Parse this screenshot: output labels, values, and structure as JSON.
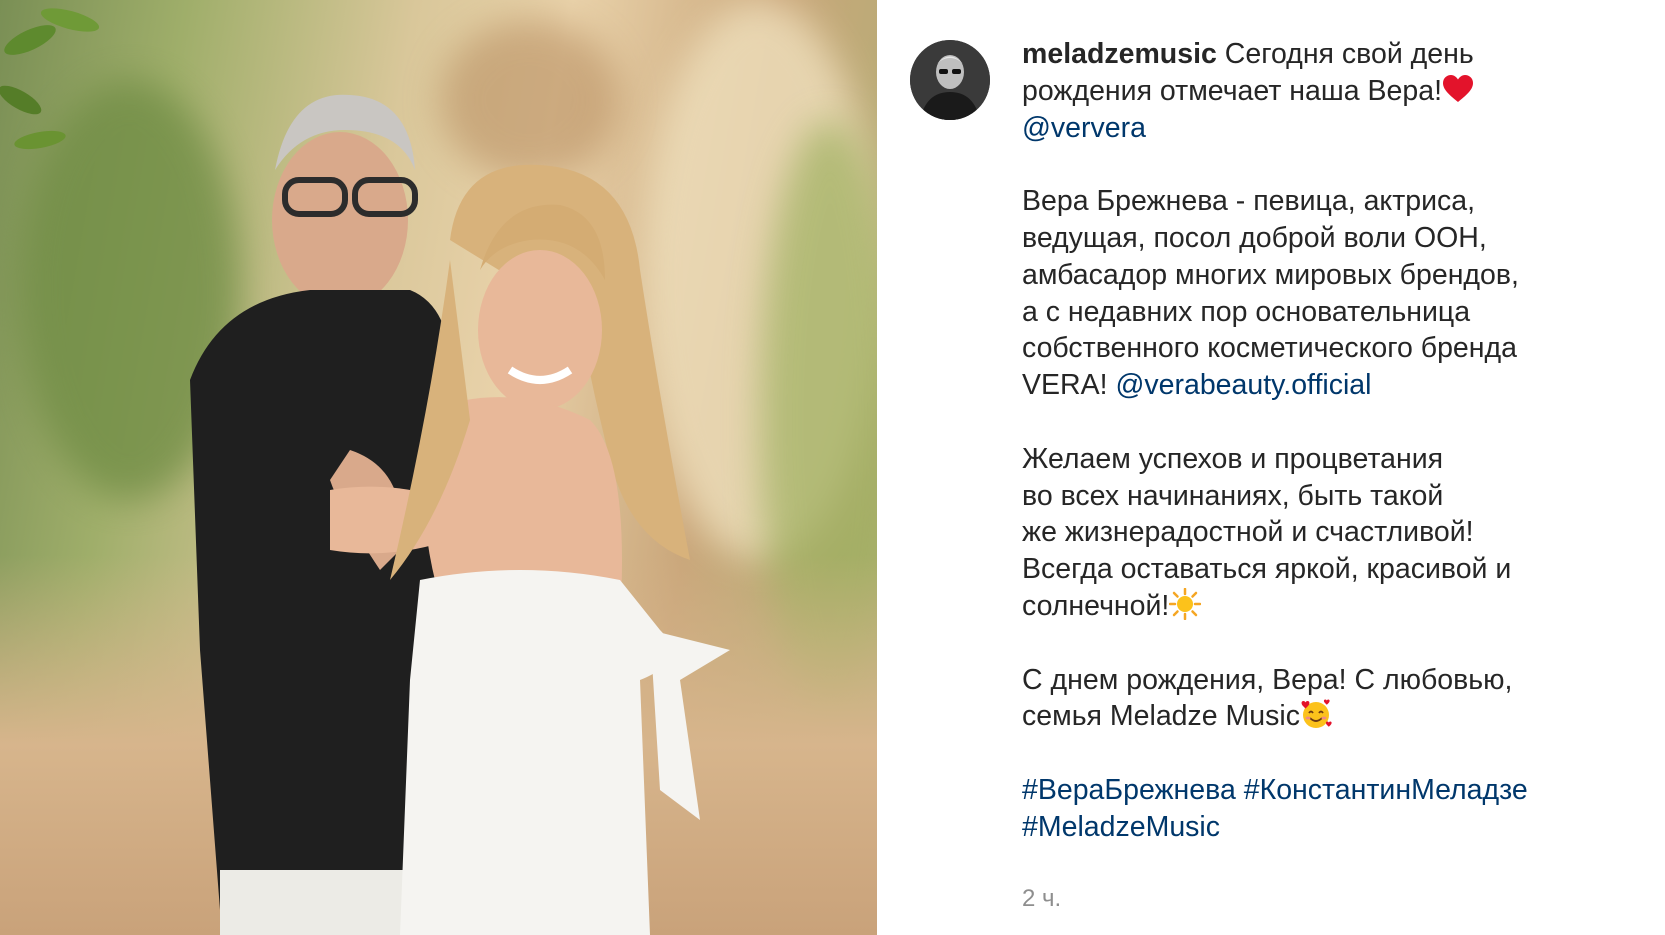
{
  "post": {
    "username": "meladzemusic",
    "line1": " Сегодня свой день",
    "line2": "рождения отмечает наша Вера!",
    "emoji_heart": "heart-emoji",
    "mention1": "@ververa",
    "para2_lines": [
      "Вера Брежнева - певица, актриса,",
      "ведущая, посол доброй воли ООН,",
      "амбасадор многих мировых брендов,",
      "а с недавних пор основательница",
      "собственного косметического бренда"
    ],
    "para2_last_prefix": "VERA! ",
    "mention2": "@verabeauty.official",
    "para3_lines": [
      "Желаем успехов и процветания",
      "во всех начинаниях, быть такой",
      "же жизнерадостной и счастливой!",
      "Всегда оставаться яркой, красивой и"
    ],
    "para3_last": "солнечной!",
    "emoji_sun": "sun-emoji",
    "para4_line1": "С днем рождения, Вера! С любовью,",
    "para4_line2": "семья Meladze Music",
    "emoji_hearts_face": "smiling-face-with-hearts-emoji",
    "hashtags_line1": "#ВераБрежнева #КонстантинМеладзе",
    "hashtags_line2": "#MeladzeMusic",
    "timestamp": "2 ч."
  },
  "colors": {
    "text": "#262626",
    "link": "#00376b",
    "muted": "#8e8e8e"
  }
}
